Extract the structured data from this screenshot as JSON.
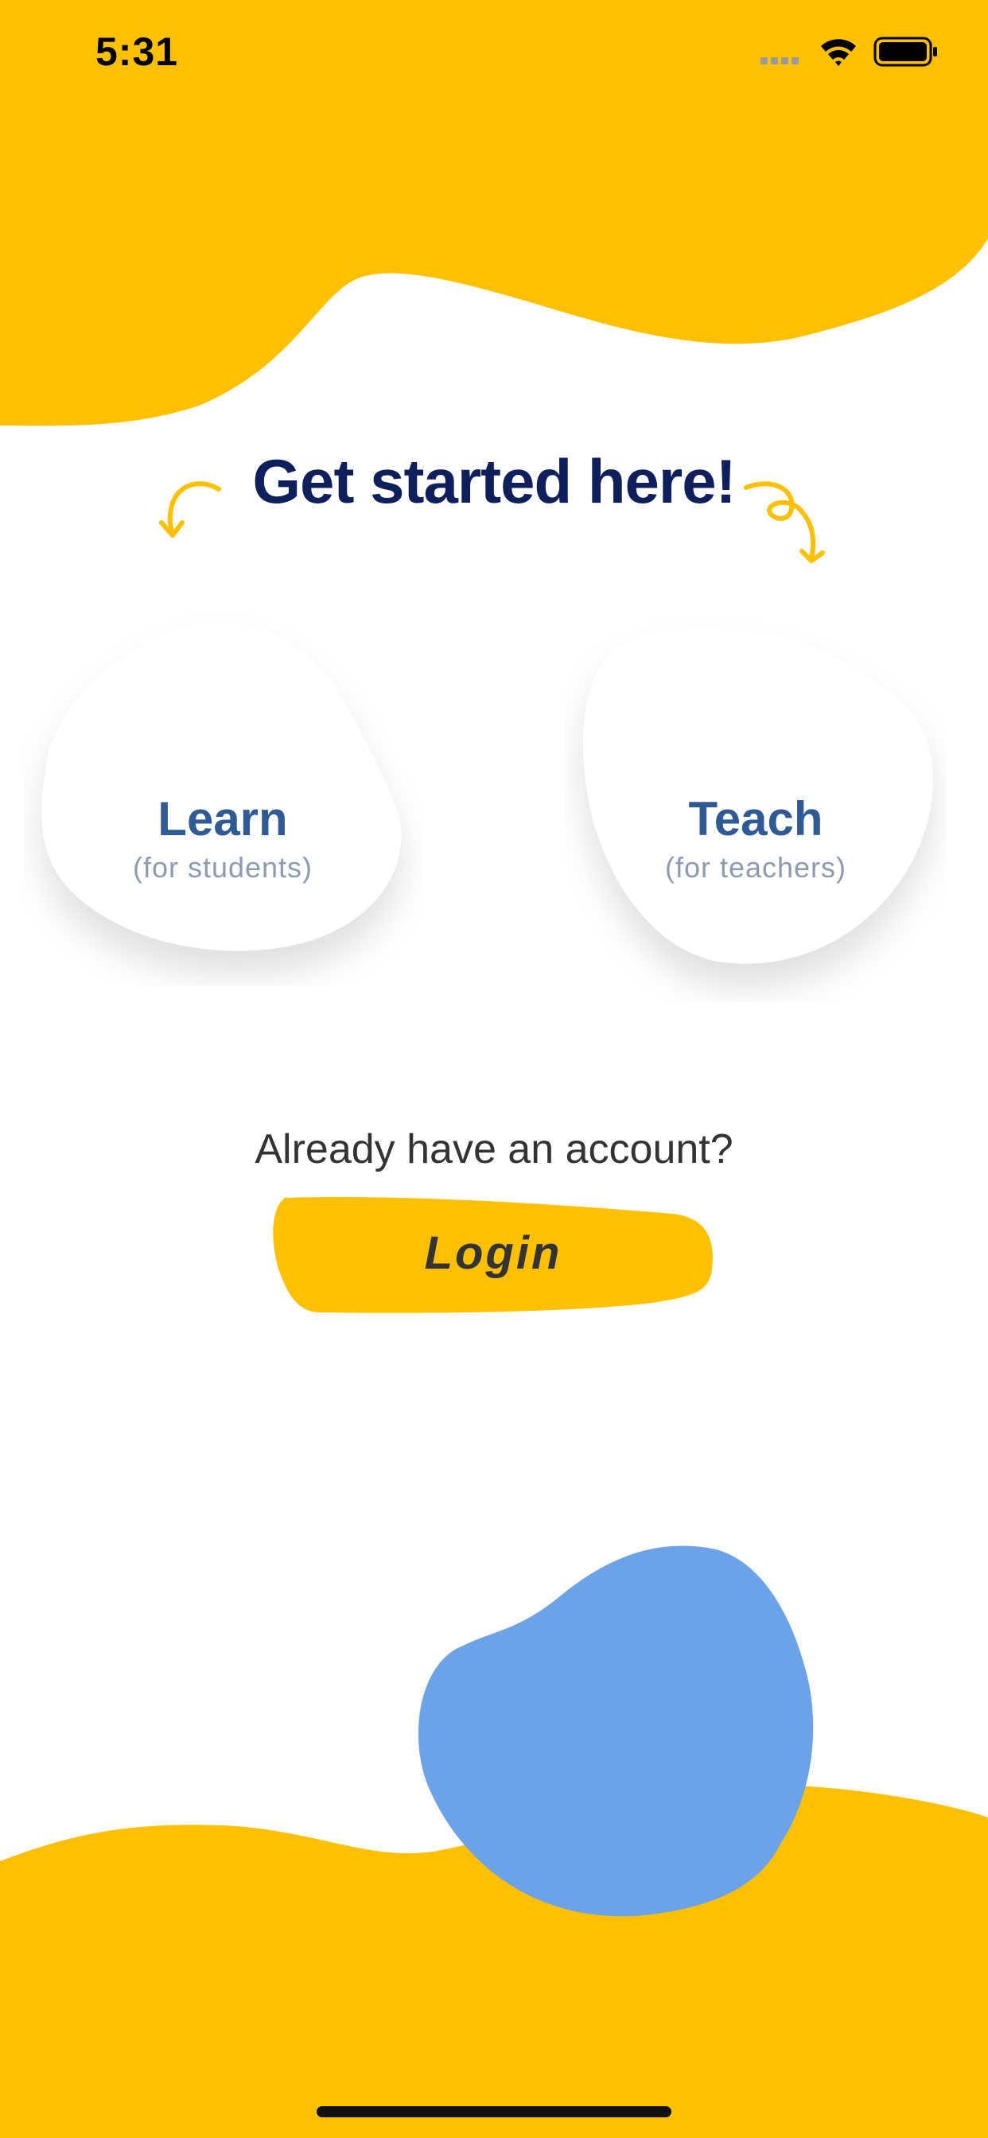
{
  "status_bar": {
    "time": "5:31",
    "icons": [
      "signal-icon",
      "wifi-icon",
      "battery-icon"
    ]
  },
  "header": {
    "title": "Get started here!"
  },
  "roles": {
    "learn": {
      "label": "Learn",
      "sublabel": "(for students)"
    },
    "teach": {
      "label": "Teach",
      "sublabel": "(for teachers)"
    }
  },
  "account": {
    "prompt": "Already have an account?",
    "login_label": "Login"
  },
  "colors": {
    "accent_yellow": "#FFC000",
    "blob_blue": "#6CA2E8",
    "title_navy": "#0F1F5C",
    "card_text_blue": "#2F5A93",
    "card_subtext_gray": "#8D9AB0"
  }
}
